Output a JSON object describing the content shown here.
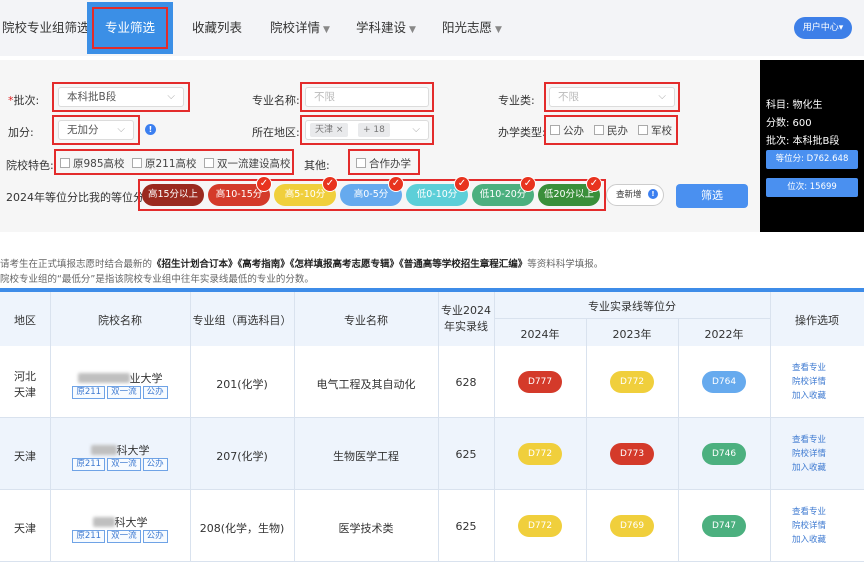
{
  "nav": {
    "items": [
      {
        "label": "院校专业组筛选",
        "dropdown": false
      },
      {
        "label": "专业筛选",
        "dropdown": false,
        "active": true
      },
      {
        "label": "收藏列表",
        "dropdown": false
      },
      {
        "label": "院校详情",
        "dropdown": true
      },
      {
        "label": "学科建设",
        "dropdown": true
      },
      {
        "label": "阳光志愿",
        "dropdown": true
      }
    ],
    "user_center": "用户中心"
  },
  "filters": {
    "batch_label": "批次:",
    "batch_required_mark": "*",
    "batch_value": "本科批B段",
    "major_name_label": "专业名称:",
    "major_name_placeholder": "不限",
    "major_category_label": "专业类:",
    "major_category_placeholder": "不限",
    "bonus_label": "加分:",
    "bonus_value": "无加分",
    "region_label": "所在地区:",
    "region_tag": "天津 ×",
    "region_more": "+ 18",
    "school_type_label": "办学类型:",
    "school_types": [
      "公办",
      "民办",
      "军校"
    ],
    "feature_label": "院校特色:",
    "features": [
      "原985高校",
      "原211高校",
      "双一流建设高校"
    ],
    "other_label": "其他:",
    "other_options": [
      "合作办学"
    ],
    "rank_label": "2024年等位分比我的等位分:",
    "rank_buttons": [
      {
        "label": "高15分以上",
        "color": "#9b2a1f",
        "checked": false
      },
      {
        "label": "高10-15分",
        "color": "#d43a2a",
        "checked": true
      },
      {
        "label": "高5-10分",
        "color": "#f0cf3c",
        "checked": true
      },
      {
        "label": "高0-5分",
        "color": "#66aaee",
        "checked": true
      },
      {
        "label": "低0-10分",
        "color": "#5ccfd8",
        "checked": true
      },
      {
        "label": "低10-20分",
        "color": "#4cb07f",
        "checked": true
      },
      {
        "label": "低20分以上",
        "color": "#3a8f3a",
        "checked": true
      }
    ],
    "new_add_label": "查新增",
    "filter_button": "筛选"
  },
  "side_panel": {
    "subject": "科目: 物化生",
    "score": "分数: 600",
    "batch": "批次: 本科批B段",
    "equiv_score": "等位分: D762.648",
    "rank": "位次: 15699"
  },
  "notes": {
    "line1_prefix": "请考生在正式填报志愿时结合最新的",
    "line1_bold": "《招生计划合订本》《高考指南》《怎样填报高考志愿专辑》《普通高等学校招生章程汇编》",
    "line1_suffix": "等资料科学填报。",
    "line2": "院校专业组的“最低分”是指该院校专业组中往年实录线最低的专业的分数。"
  },
  "table": {
    "headers": {
      "region": "地区",
      "school": "院校名称",
      "group": "专业组（再选科目）",
      "major": "专业名称",
      "line2024_a": "专业2024",
      "line2024_b": "年实录线",
      "equiv_group": "专业实录线等位分",
      "y2024": "2024年",
      "y2023": "2023年",
      "y2022": "2022年",
      "ops": "操作选项"
    },
    "rows": [
      {
        "region_line1": "河北",
        "region_line2": "天津",
        "school_suffix": "业大学",
        "tags": [
          "原211",
          "双一流",
          "公办"
        ],
        "group": "201(化学)",
        "major": "电气工程及其自动化",
        "line2024": "628",
        "d2024": {
          "text": "D777",
          "color": "#d43a2a"
        },
        "d2023": {
          "text": "D772",
          "color": "#f0cf3c"
        },
        "d2022": {
          "text": "D764",
          "color": "#66aaee"
        },
        "ops": [
          "查看专业",
          "院校详情",
          "加入收藏"
        ]
      },
      {
        "region_line1": "天津",
        "region_line2": "",
        "school_suffix": "科大学",
        "tags": [
          "原211",
          "双一流",
          "公办"
        ],
        "group": "207(化学)",
        "major": "生物医学工程",
        "line2024": "625",
        "d2024": {
          "text": "D772",
          "color": "#f0cf3c"
        },
        "d2023": {
          "text": "D773",
          "color": "#d43a2a"
        },
        "d2022": {
          "text": "D746",
          "color": "#4cb07f"
        },
        "ops": [
          "查看专业",
          "院校详情",
          "加入收藏"
        ]
      },
      {
        "region_line1": "天津",
        "region_line2": "",
        "school_suffix": "科大学",
        "tags": [
          "原211",
          "双一流",
          "公办"
        ],
        "group": "208(化学，生物)",
        "major": "医学技术类",
        "line2024": "625",
        "d2024": {
          "text": "D772",
          "color": "#f0cf3c"
        },
        "d2023": {
          "text": "D769",
          "color": "#f0cf3c"
        },
        "d2022": {
          "text": "D747",
          "color": "#4cb07f"
        },
        "ops": [
          "查看专业",
          "院校详情",
          "加入收藏"
        ]
      }
    ]
  }
}
